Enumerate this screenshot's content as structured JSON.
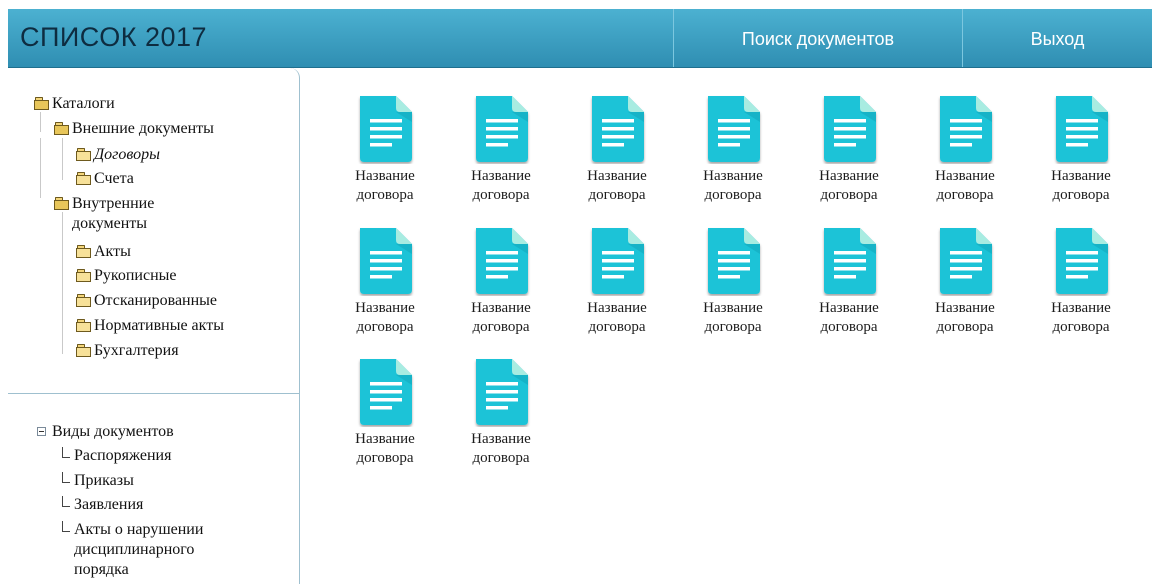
{
  "header": {
    "title": "СПИСОК 2017",
    "nav": {
      "search": "Поиск документов",
      "exit": "Выход"
    }
  },
  "catalog_tree": {
    "root": "Каталоги",
    "external": {
      "label": "Внешние документы",
      "children": [
        "Договоры",
        "Счета"
      ]
    },
    "internal": {
      "label_line1": "Внутренние",
      "label_line2": "документы",
      "children": [
        "Акты",
        "Рукописные",
        "Отсканированные",
        "Нормативные акты",
        "Бухгалтерия"
      ]
    }
  },
  "types_tree": {
    "root": "Виды документов",
    "items": [
      "Распоряжения",
      "Приказы",
      "Заявления"
    ],
    "last_item_lines": [
      "Акты о нарушении",
      "дисциплинарного",
      "порядка"
    ]
  },
  "documents": {
    "label_line1": "Название",
    "label_line2": "договора",
    "count": 16
  },
  "colors": {
    "header": "#3a9fc2",
    "doc_icon": "#1ec3d7",
    "doc_fold": "#a8ece1"
  },
  "icons": {
    "folder": "folder-icon",
    "document": "document-icon",
    "collapse": "minus-icon"
  }
}
